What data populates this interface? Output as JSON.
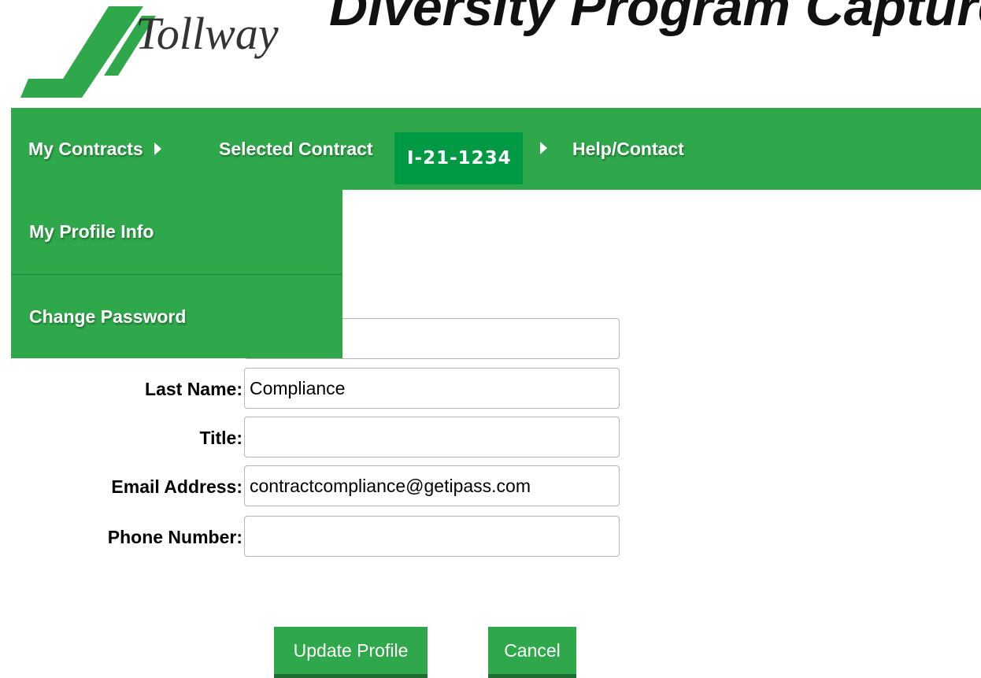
{
  "header": {
    "logo_text": "Tollway",
    "app_title": "Diversity Program Capture"
  },
  "nav": {
    "my_contracts": "My Contracts",
    "selected_contract": "Selected Contract",
    "contract_number": "I-21-1234",
    "help": "Help/Contact"
  },
  "dropdown": {
    "items": [
      {
        "label": "My Profile Info"
      },
      {
        "label": "Change Password"
      }
    ]
  },
  "form": {
    "last_name": {
      "label": "Last Name:",
      "value": "Compliance"
    },
    "title": {
      "label": "Title:",
      "value": ""
    },
    "email": {
      "label": "Email Address:",
      "value": "contractcompliance@getipass.com"
    },
    "phone": {
      "label": "Phone Number:",
      "value": ""
    }
  },
  "buttons": {
    "update": "Update Profile",
    "cancel": "Cancel"
  },
  "colors": {
    "nav_green": "#2ea84a",
    "badge_green": "#009a44",
    "logo_green": "#2ea84a"
  }
}
